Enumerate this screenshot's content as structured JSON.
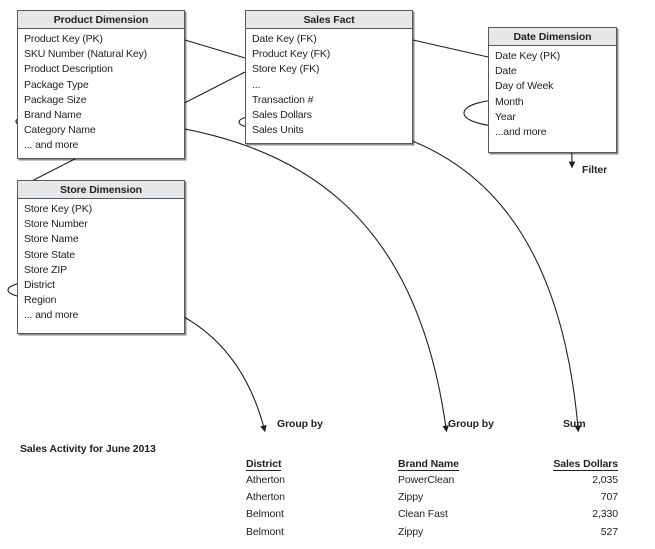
{
  "diagram": {
    "title_caption": "Sales Activity for June 2013",
    "entities": [
      {
        "name": "product-dimension",
        "header": "Product Dimension",
        "fields": [
          "Product Key (PK)",
          "SKU Number (Natural Key)",
          "Product Description",
          "Package Type",
          "Package Size",
          "Brand Name",
          "Category Name",
          "... and more"
        ],
        "highlighted_field": "Brand Name"
      },
      {
        "name": "sales-fact",
        "header": "Sales Fact",
        "fields": [
          "Date Key (FK)",
          "Product Key (FK)",
          "Store Key (FK)",
          "...",
          "Transaction #",
          "Sales Dollars",
          "Sales Units"
        ],
        "highlighted_field": "Sales Dollars"
      },
      {
        "name": "date-dimension",
        "header": "Date Dimension",
        "fields": [
          "Date Key (PK)",
          "Date",
          "Day of Week",
          "Month",
          "Year",
          "...and more"
        ],
        "highlighted_field": "Month / Year"
      },
      {
        "name": "store-dimension",
        "header": "Store Dimension",
        "fields": [
          "Store Key (PK)",
          "Store Number",
          "Store Name",
          "Store State",
          "Store ZIP",
          "District",
          "Region",
          "... and more"
        ],
        "highlighted_field": "District"
      }
    ],
    "annotations": [
      {
        "name": "filter",
        "label": "Filter"
      },
      {
        "name": "group-by-district",
        "label": "Group by"
      },
      {
        "name": "group-by-brand",
        "label": "Group by"
      },
      {
        "name": "sum-sales",
        "label": "Sum"
      }
    ]
  },
  "result_table": {
    "columns": [
      {
        "key": "district",
        "label": "District",
        "align": "left"
      },
      {
        "key": "brand",
        "label": "Brand Name",
        "align": "left"
      },
      {
        "key": "sales",
        "label": "Sales Dollars",
        "align": "right"
      }
    ],
    "rows": [
      {
        "district": "Atherton",
        "brand": "PowerClean",
        "sales": "2,035"
      },
      {
        "district": "Atherton",
        "brand": "Zippy",
        "sales": "707"
      },
      {
        "district": "Belmont",
        "brand": "Clean Fast",
        "sales": "2,330"
      },
      {
        "district": "Belmont",
        "brand": "Zippy",
        "sales": "527"
      }
    ]
  },
  "colors": {
    "line": "#231f20",
    "box_border": "#58595b",
    "header_fill": "#e6e7e8",
    "text": "#231f20",
    "background": "#ffffff"
  }
}
